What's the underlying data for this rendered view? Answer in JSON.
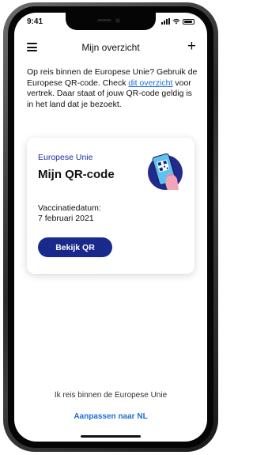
{
  "status": {
    "time": "9:41"
  },
  "nav": {
    "title": "Mijn overzicht",
    "menu_icon": "hamburger-menu-icon",
    "add_icon": "plus-icon",
    "add_symbol": "+"
  },
  "intro": {
    "text_before": "Op reis binnen de Europese Unie? Gebruik de Europese QR-code. Check ",
    "link_text": "dit overzicht",
    "text_after": " voor vertrek. Daar staat of jouw QR-code geldig is in het land dat je bezoekt."
  },
  "card": {
    "region": "Europese Unie",
    "title": "Mijn QR-code",
    "date_label": "Vaccinatiedatum:",
    "date_value": "7 februari 2021",
    "button_label": "Bekijk QR",
    "illustration_icon": "phone-qr-code-icon"
  },
  "footer": {
    "text": "Ik reis binnen de Europese Unie",
    "link": "Aanpassen naar NL"
  },
  "colors": {
    "primary": "#1a2a8c",
    "link": "#1a6ed8",
    "region_label": "#1a2fa8",
    "badge_circle": "#202b8c",
    "hand": "#f2a4b8",
    "phone_screen": "#5ec2f0"
  }
}
